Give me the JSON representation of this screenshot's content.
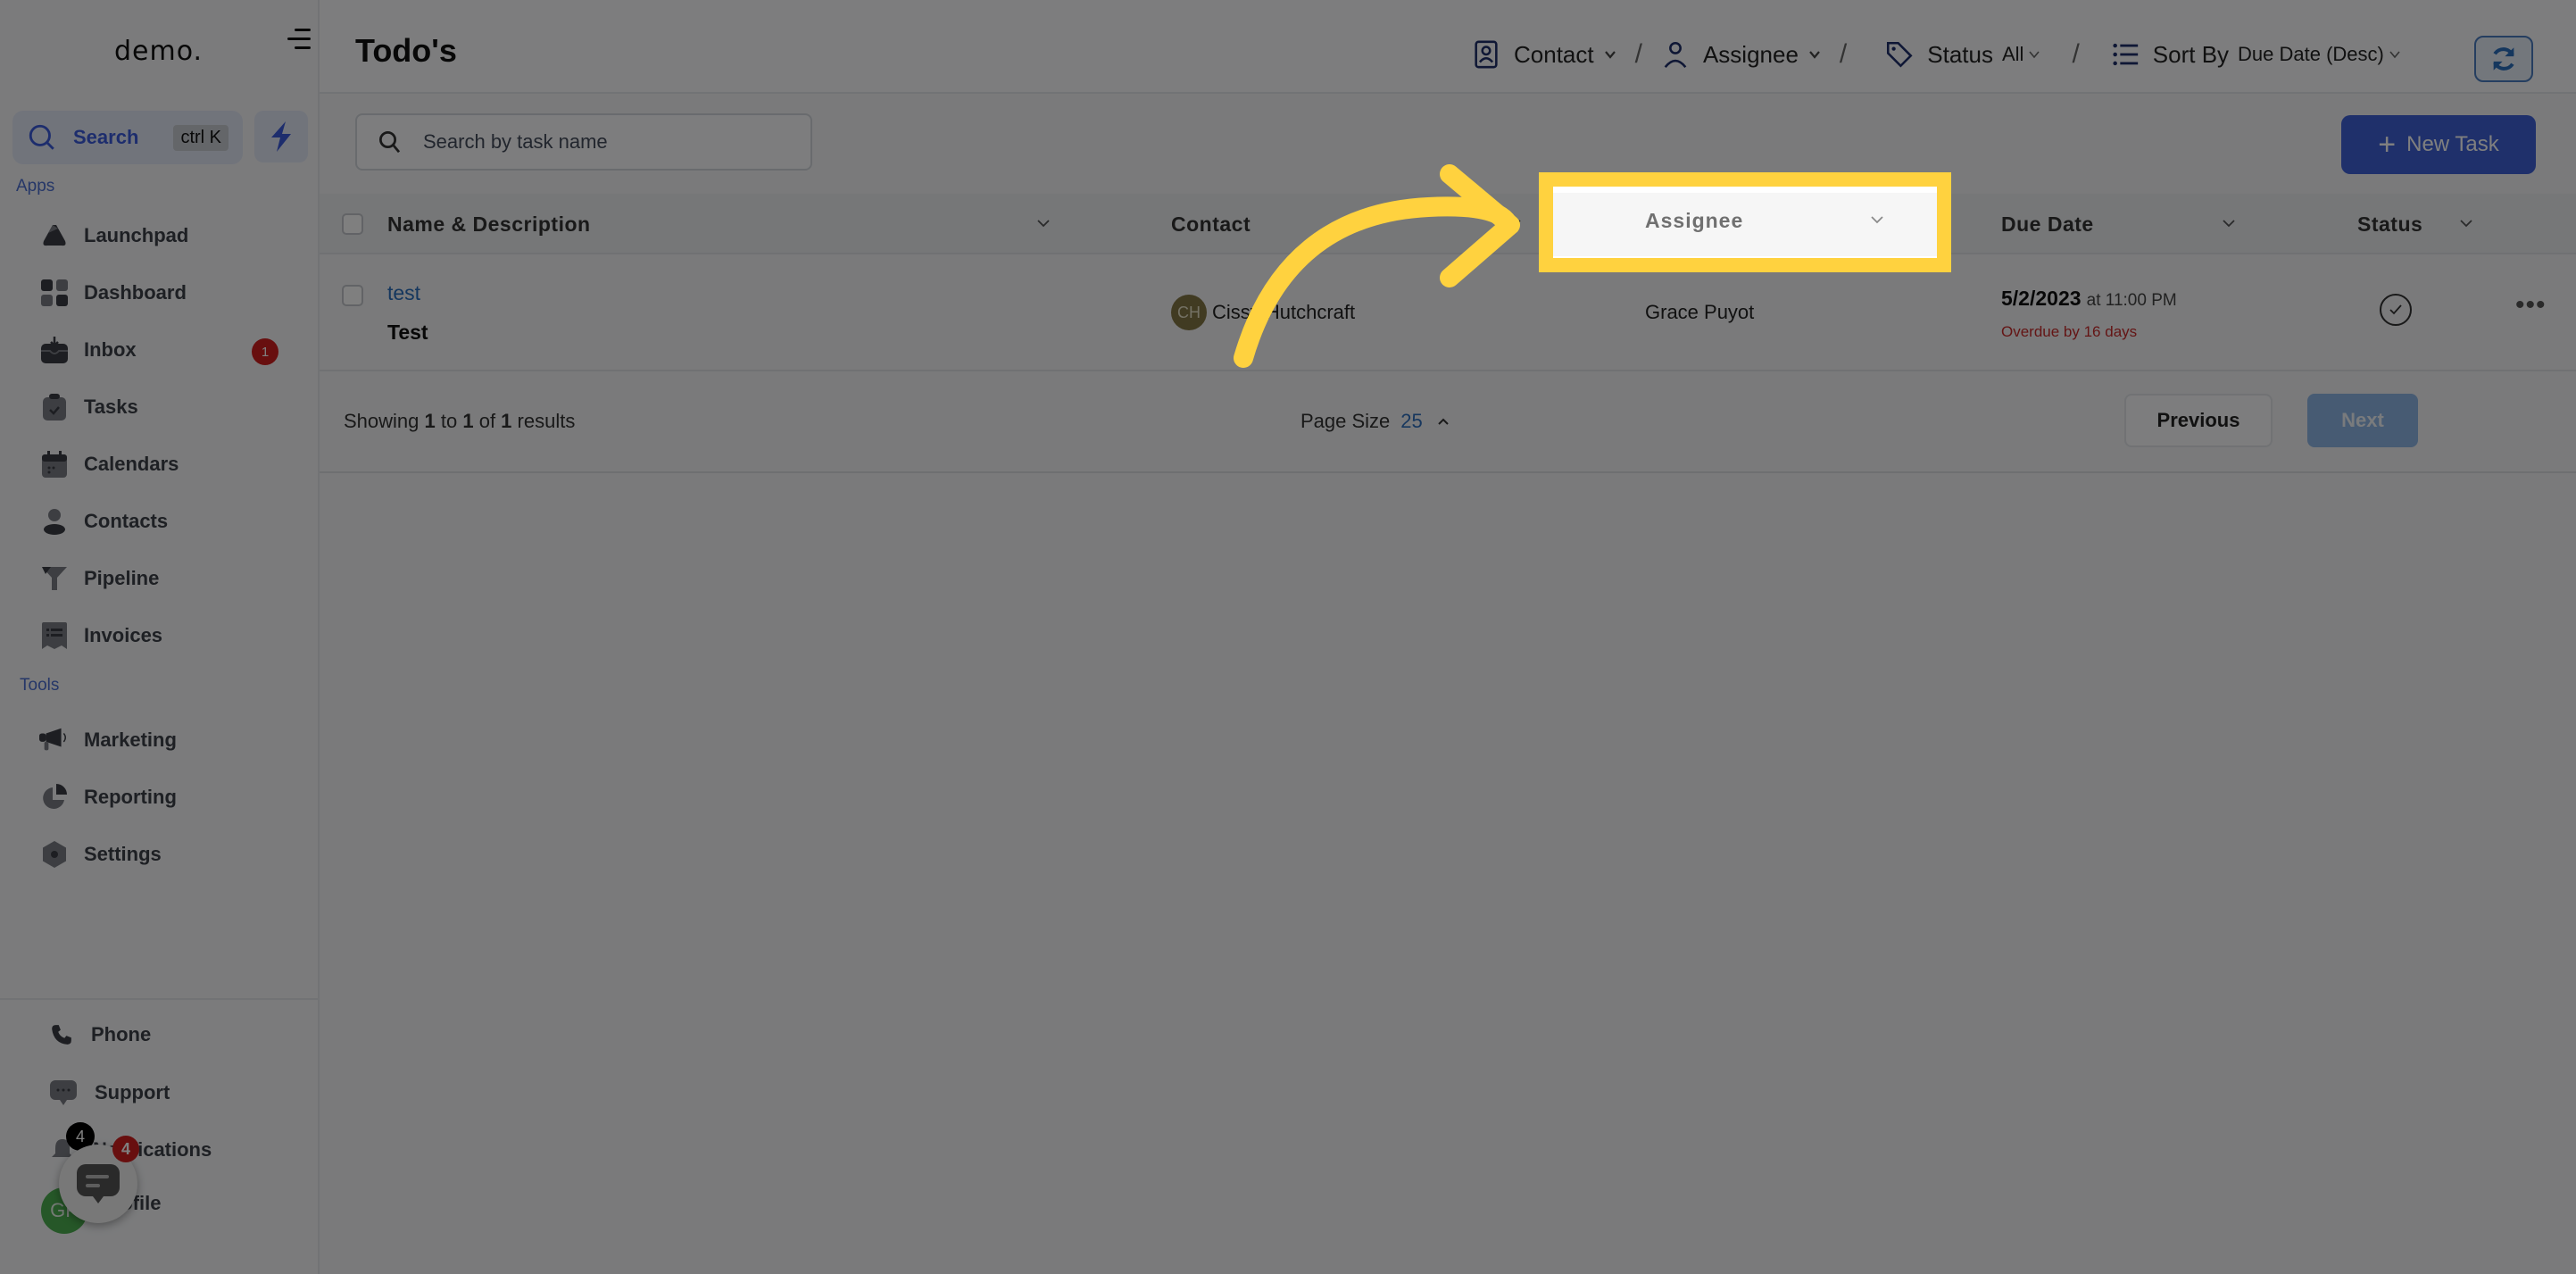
{
  "sidebar": {
    "logo": "demo.",
    "search": {
      "label": "Search",
      "shortcut": "ctrl K"
    },
    "sections": {
      "apps": "Apps",
      "tools": "Tools"
    },
    "apps": [
      {
        "label": "Launchpad",
        "icon": "rocket-icon"
      },
      {
        "label": "Dashboard",
        "icon": "dashboard-icon"
      },
      {
        "label": "Inbox",
        "icon": "inbox-icon",
        "badge": "1"
      },
      {
        "label": "Tasks",
        "icon": "clipboard-check-icon"
      },
      {
        "label": "Calendars",
        "icon": "calendar-icon"
      },
      {
        "label": "Contacts",
        "icon": "person-icon"
      },
      {
        "label": "Pipeline",
        "icon": "funnel-icon"
      },
      {
        "label": "Invoices",
        "icon": "receipt-icon"
      }
    ],
    "tools": [
      {
        "label": "Marketing",
        "icon": "megaphone-icon"
      },
      {
        "label": "Reporting",
        "icon": "pie-chart-icon"
      },
      {
        "label": "Settings",
        "icon": "settings-icon"
      }
    ],
    "bottom": {
      "phone": "Phone",
      "support": "Support",
      "notifications": "Notifications",
      "notifications_badge": "4",
      "profile": "Profile",
      "profile_initials": "GP",
      "chat_badge": "4"
    }
  },
  "header": {
    "title": "Todo's",
    "filters": {
      "contact": "Contact",
      "assignee": "Assignee",
      "status_label": "Status",
      "status_value": "All",
      "sort_label": "Sort By",
      "sort_value": "Due Date (Desc)"
    },
    "separator": "/"
  },
  "toolbar": {
    "search_placeholder": "Search by task name",
    "new_task_label": "New Task"
  },
  "table": {
    "columns": [
      "Name & Description",
      "Contact",
      "Assignee",
      "Due Date",
      "Status"
    ],
    "rows": [
      {
        "name": "test",
        "description": "Test",
        "contact": "Cissy Hutchcraft",
        "contact_initials": "CH",
        "assignee": "Grace Puyot",
        "due_date": "5/2/2023",
        "due_time": "at 11:00 PM",
        "overdue": "Overdue by 16 days"
      }
    ],
    "footer": {
      "showing_prefix": "Showing ",
      "from": "1",
      "to_word": " to ",
      "to": "1",
      "of_word": " of ",
      "total": "1",
      "suffix": " results",
      "page_size_label": "Page Size",
      "page_size_value": "25",
      "previous": "Previous",
      "next": "Next"
    }
  },
  "highlight": {
    "label": "Assignee",
    "color": "#ffd23f"
  },
  "colors": {
    "accent": "#3f61d6",
    "link": "#2a6ebd",
    "overdue": "#c82a2a",
    "badge": "#d11f1f",
    "annotation": "#ffd23f"
  }
}
